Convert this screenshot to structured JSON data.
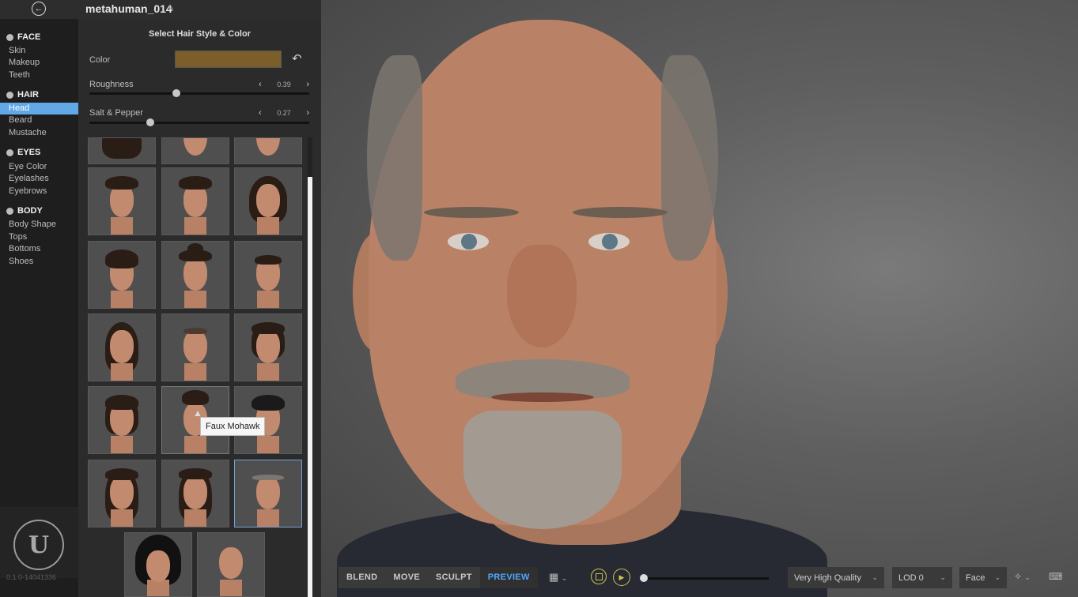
{
  "app": {
    "title": "metahuman_014"
  },
  "nav": {
    "categories": [
      {
        "label": "FACE",
        "items": [
          "Skin",
          "Makeup",
          "Teeth"
        ]
      },
      {
        "label": "HAIR",
        "items": [
          "Head",
          "Beard",
          "Mustache"
        ]
      },
      {
        "label": "EYES",
        "items": [
          "Eye Color",
          "Eyelashes",
          "Eyebrows"
        ]
      },
      {
        "label": "BODY",
        "items": [
          "Body Shape",
          "Tops",
          "Bottoms",
          "Shoes"
        ]
      }
    ],
    "active_item": "Head",
    "version": "0.1.0-14041336"
  },
  "panel": {
    "title": "Select Hair Style & Color",
    "color_label": "Color",
    "color_value": "#7c5e2b",
    "roughness": {
      "label": "Roughness",
      "value": "0.39"
    },
    "salt_pepper": {
      "label": "Salt & Pepper",
      "value": "0.27"
    },
    "tooltip": "Faux Mohawk"
  },
  "toolbar": {
    "modes": [
      "BLEND",
      "MOVE",
      "SCULPT",
      "PREVIEW"
    ],
    "active_mode": "PREVIEW",
    "quality": "Very High Quality",
    "lod": "LOD 0",
    "camera": "Face"
  },
  "icons": {
    "back": "back-arrow-icon",
    "edit": "pencil-icon",
    "undo": "undo-icon",
    "film": "film-icon",
    "stop": "stop-icon",
    "play": "play-icon",
    "light": "light-rig-icon",
    "keyboard": "keyboard-icon"
  }
}
